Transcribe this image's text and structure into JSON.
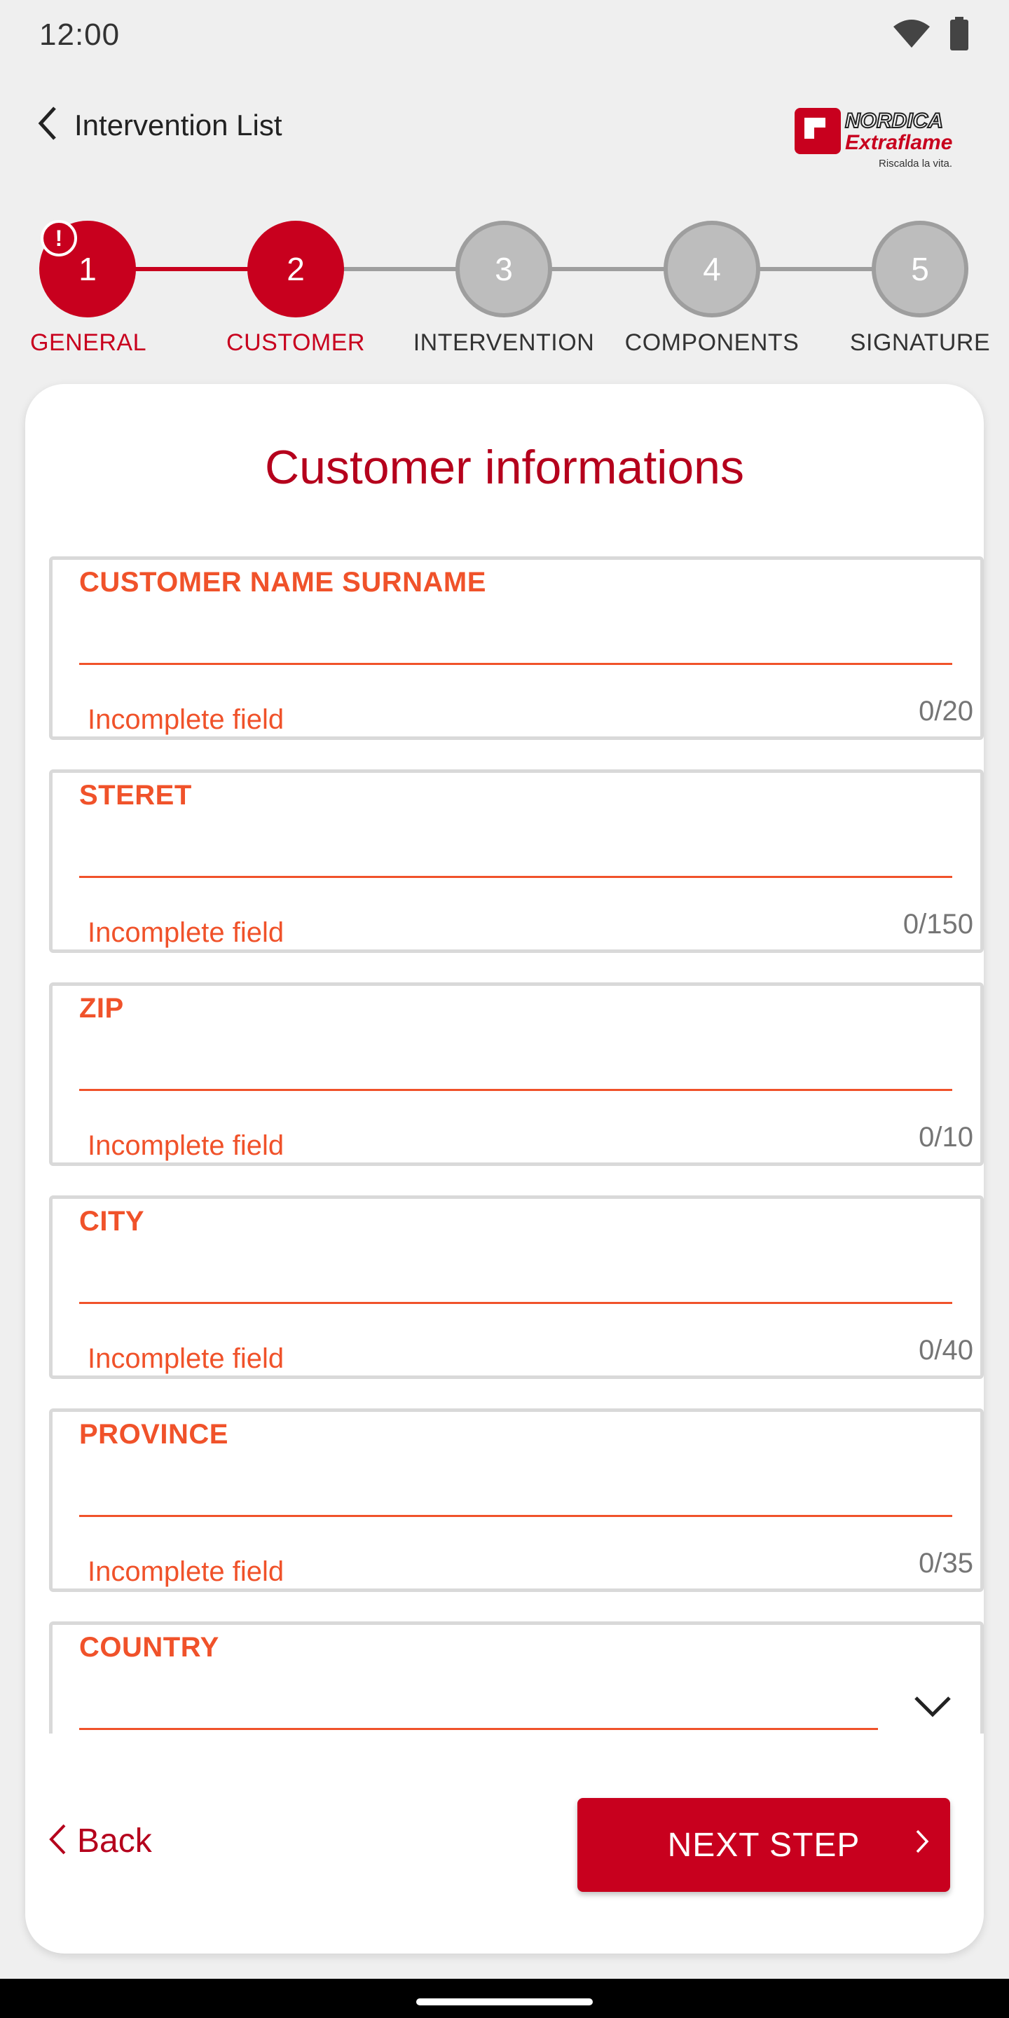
{
  "status_bar": {
    "time": "12:00",
    "icons": [
      "wifi-icon",
      "battery-icon"
    ]
  },
  "header": {
    "back_label": "Intervention List",
    "logo": {
      "line1": "NORDICA",
      "line2": "Extraflame",
      "tagline": "Riscalda la vita."
    }
  },
  "stepper": {
    "current_step": 2,
    "steps": [
      {
        "number": "1",
        "label": "GENERAL",
        "state": "error"
      },
      {
        "number": "2",
        "label": "CUSTOMER",
        "state": "active"
      },
      {
        "number": "3",
        "label": "INTERVENTION",
        "state": "inactive"
      },
      {
        "number": "4",
        "label": "COMPONENTS",
        "state": "inactive"
      },
      {
        "number": "5",
        "label": "SIGNATURE",
        "state": "inactive"
      }
    ]
  },
  "form": {
    "title": "Customer informations",
    "fields": [
      {
        "label": "CUSTOMER NAME SURNAME",
        "value": "",
        "error": "Incomplete field",
        "counter": "0/20"
      },
      {
        "label": "STERET",
        "value": "",
        "error": "Incomplete field",
        "counter": "0/150"
      },
      {
        "label": "ZIP",
        "value": "",
        "error": "Incomplete field",
        "counter": "0/10"
      },
      {
        "label": "CITY",
        "value": "",
        "error": "Incomplete field",
        "counter": "0/40"
      },
      {
        "label": "PROVINCE",
        "value": "",
        "error": "Incomplete field",
        "counter": "0/35"
      },
      {
        "label": "COUNTRY",
        "value": "",
        "type": "dropdown"
      }
    ]
  },
  "actions": {
    "back_label": "Back",
    "next_label": "NEXT STEP"
  },
  "colors": {
    "primary": "#c8001e",
    "error": "#f0522a",
    "inactive": "#bdbdbd",
    "background": "#efefef"
  }
}
